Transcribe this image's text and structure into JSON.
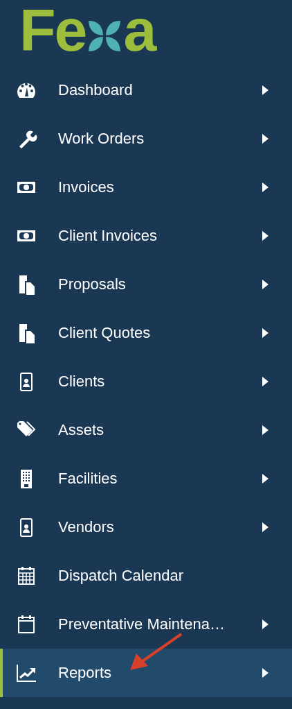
{
  "logo": {
    "before": "Fe",
    "after": "a"
  },
  "menu": [
    {
      "label": "Dashboard",
      "has_submenu": true,
      "selected": false
    },
    {
      "label": "Work Orders",
      "has_submenu": true,
      "selected": false
    },
    {
      "label": "Invoices",
      "has_submenu": true,
      "selected": false
    },
    {
      "label": "Client Invoices",
      "has_submenu": true,
      "selected": false
    },
    {
      "label": "Proposals",
      "has_submenu": true,
      "selected": false
    },
    {
      "label": "Client Quotes",
      "has_submenu": true,
      "selected": false
    },
    {
      "label": "Clients",
      "has_submenu": true,
      "selected": false
    },
    {
      "label": "Assets",
      "has_submenu": true,
      "selected": false
    },
    {
      "label": "Facilities",
      "has_submenu": true,
      "selected": false
    },
    {
      "label": "Vendors",
      "has_submenu": true,
      "selected": false
    },
    {
      "label": "Dispatch Calendar",
      "has_submenu": false,
      "selected": false
    },
    {
      "label": "Preventative Maintena…",
      "has_submenu": true,
      "selected": false
    },
    {
      "label": "Reports",
      "has_submenu": true,
      "selected": true
    }
  ]
}
